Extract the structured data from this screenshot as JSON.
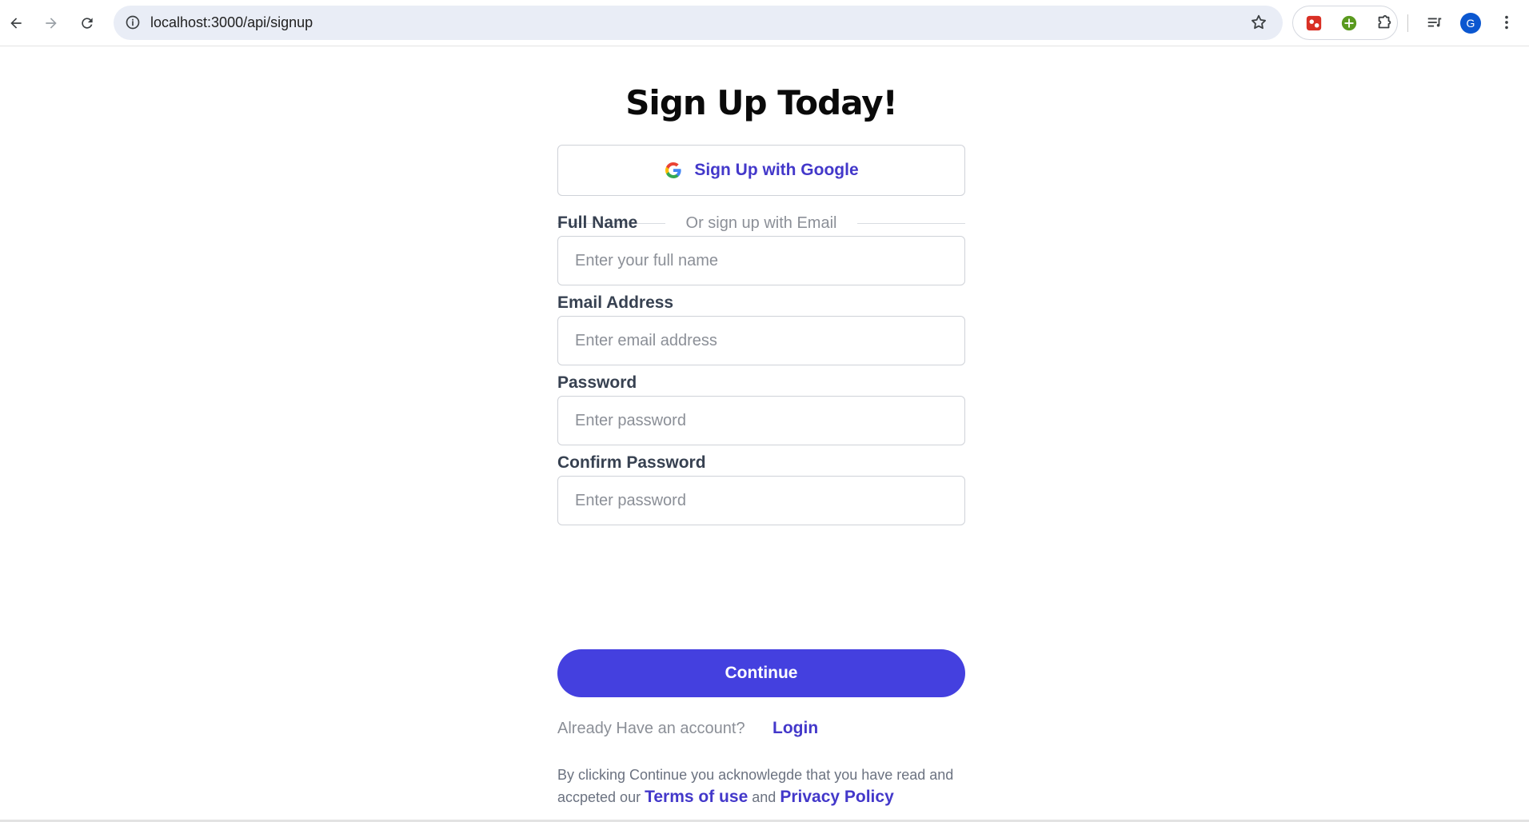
{
  "browser": {
    "url": "localhost:3000/api/signup",
    "profile_initial": "G",
    "icons": [
      "back-icon",
      "forward-icon",
      "reload-icon",
      "site-info-icon",
      "bookmark-star-icon",
      "extension-red-icon",
      "extension-green-plus-icon",
      "extensions-puzzle-icon",
      "reading-list-icon",
      "menu-kebab-icon"
    ]
  },
  "form": {
    "title": "Sign Up Today!",
    "google_button": "Sign Up with Google",
    "divider_text": "Or sign up with Email",
    "fields": {
      "full_name": {
        "label": "Full Name",
        "placeholder": "Enter your full name"
      },
      "email": {
        "label": "Email Address",
        "placeholder": "Enter email address"
      },
      "password": {
        "label": "Password",
        "placeholder": "Enter password"
      },
      "confirm_password": {
        "label": "Confirm Password",
        "placeholder": "Enter password"
      }
    },
    "continue_button": "Continue",
    "have_account_text": "Already Have an account?",
    "login_link": "Login",
    "legal": {
      "prefix": "By clicking Continue you acknowlegde that you have read and accpeted our",
      "terms": "Terms of use",
      "and": "and",
      "privacy": "Privacy Policy"
    }
  },
  "colors": {
    "accent": "#4440df",
    "link": "#4338ca",
    "muted_text": "#8b8f97",
    "input_border": "#cfd2d8"
  }
}
